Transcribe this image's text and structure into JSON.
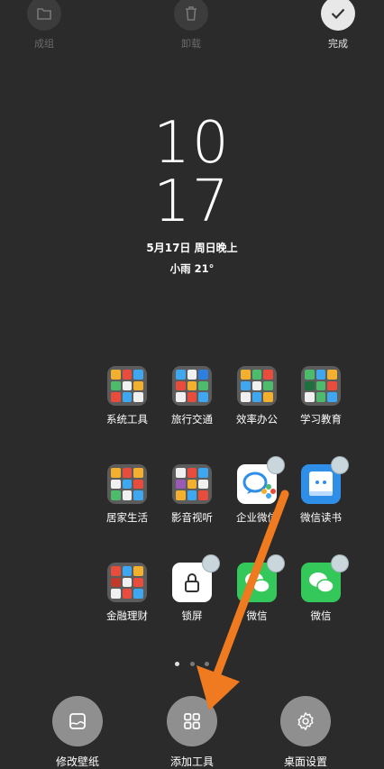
{
  "topbar": {
    "group_label": "成组",
    "uninstall_label": "卸载",
    "done_label": "完成"
  },
  "clock": {
    "hour": "10",
    "minute": "17"
  },
  "date": "5月17日 周日晚上",
  "weather": "小雨  21°",
  "apps": [
    {
      "label": "系统工具",
      "type": "folder",
      "name": "folder-system-tools"
    },
    {
      "label": "旅行交通",
      "type": "folder",
      "name": "folder-travel"
    },
    {
      "label": "效率办公",
      "type": "folder",
      "name": "folder-office"
    },
    {
      "label": "学习教育",
      "type": "folder",
      "name": "folder-education"
    },
    {
      "label": "居家生活",
      "type": "folder",
      "name": "folder-home-life"
    },
    {
      "label": "影音视听",
      "type": "folder",
      "name": "folder-media"
    },
    {
      "label": "企业微信",
      "type": "app",
      "name": "app-wecom"
    },
    {
      "label": "微信读书",
      "type": "app",
      "name": "app-weread"
    },
    {
      "label": "金融理财",
      "type": "folder",
      "name": "folder-finance"
    },
    {
      "label": "锁屏",
      "type": "app",
      "name": "app-lockscreen"
    },
    {
      "label": "微信",
      "type": "app",
      "name": "app-wechat-1"
    },
    {
      "label": "微信",
      "type": "app",
      "name": "app-wechat-2"
    }
  ],
  "page_indicator": {
    "count": 3,
    "current": 1
  },
  "dock": {
    "wallpaper_label": "修改壁纸",
    "widgets_label": "添加工具",
    "settings_label": "桌面设置"
  },
  "colors": {
    "background": "#2b2b2b",
    "arrow": "#f07a1f",
    "wechat_green": "#34c759",
    "weread_blue": "#2f8ee8"
  }
}
